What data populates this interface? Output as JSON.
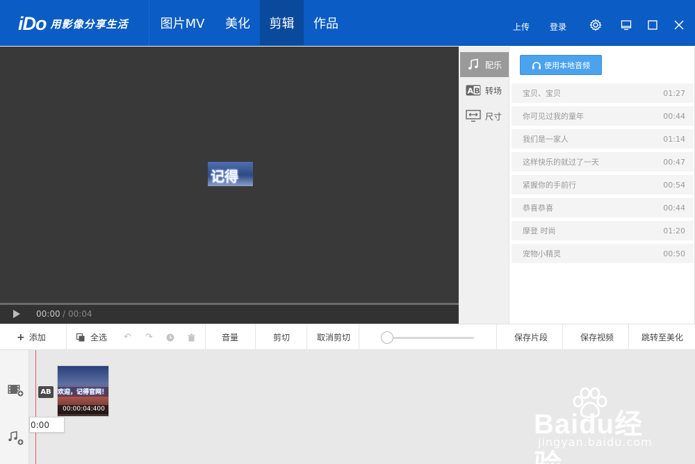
{
  "app": {
    "logo": "iDo",
    "slogan": "用影像分享生活"
  },
  "nav": {
    "tabs": [
      {
        "label": "图片MV",
        "active": false
      },
      {
        "label": "美化",
        "active": false
      },
      {
        "label": "剪辑",
        "active": true
      },
      {
        "label": "作品",
        "active": false
      }
    ],
    "upload_label": "上传",
    "login_label": "登录"
  },
  "window_controls": [
    "gear-icon",
    "skin-icon",
    "maximize-icon",
    "close-icon"
  ],
  "preview": {
    "overlay_text": "记得",
    "time_current": "00:00",
    "time_separator": "/",
    "time_total": "00:04",
    "progress_fraction": 0.0
  },
  "side_tabs": [
    {
      "label": "配乐",
      "icon": "music-note-icon",
      "active": true
    },
    {
      "label": "转场",
      "icon": "ab-transition-icon",
      "active": false
    },
    {
      "label": "尺寸",
      "icon": "size-icon",
      "active": false
    }
  ],
  "music": {
    "local_audio_label": "使用本地音频",
    "songs": [
      {
        "title": "宝贝、宝贝",
        "duration": "01:27"
      },
      {
        "title": "你可见过我的童年",
        "duration": "00:44"
      },
      {
        "title": "我们是一家人",
        "duration": "01:14"
      },
      {
        "title": "这样快乐的就过了一天",
        "duration": "00:47"
      },
      {
        "title": "紧握你的手前行",
        "duration": "00:54"
      },
      {
        "title": "恭喜恭喜",
        "duration": "00:44"
      },
      {
        "title": "摩登 时尚",
        "duration": "01:20"
      },
      {
        "title": "宠物小精灵",
        "duration": "00:50"
      }
    ]
  },
  "toolbar": {
    "add_label": "添加",
    "select_all_label": "全选",
    "volume_label": "音量",
    "cut_label": "剪切",
    "uncut_label": "取消剪切",
    "save_segment_label": "保存片段",
    "save_video_label": "保存视频",
    "goto_beautify_label": "跳转至美化",
    "zoom_level": 0.0
  },
  "timeline": {
    "transition_label": "AB",
    "clip_banner": "欢迎，记得官网！",
    "clip_time": "00:00:04:400",
    "tooltip": "0:00"
  },
  "watermark": {
    "brand": "Baidu经验",
    "url": "jingyan.baidu.com"
  },
  "colors": {
    "titlebar": "#0b5cc4",
    "active_tab": "#0a4a9c",
    "accent_button": "#4ba3ee",
    "playhead": "#e25c5c"
  }
}
